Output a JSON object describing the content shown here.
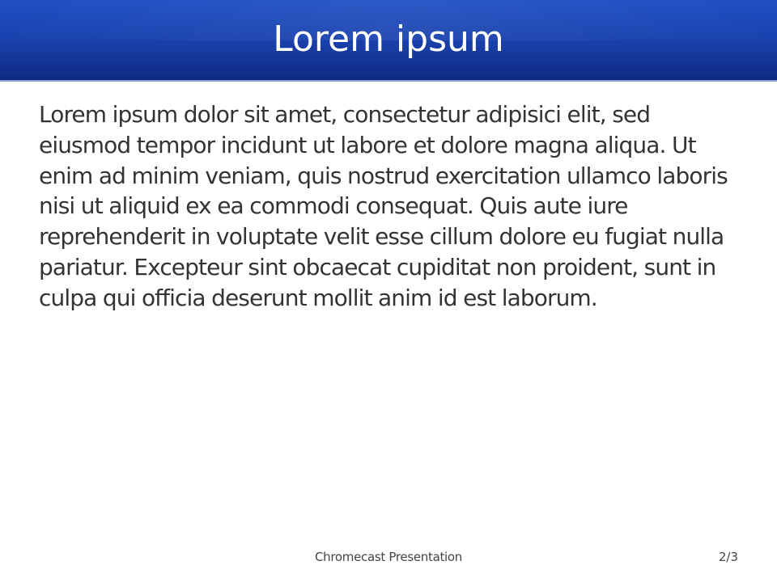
{
  "slide": {
    "title": "Lorem ipsum",
    "body": "Lorem ipsum dolor sit amet, consectetur adipisici elit, sed eiusmod tempor incidunt ut labore et dolore magna aliqua. Ut enim ad minim veniam, quis nostrud exercitation ullamco laboris nisi ut aliquid ex ea commodi consequat. Quis aute iure reprehenderit in voluptate velit esse cillum dolore eu fugiat nulla pariatur. Excepteur sint obcaecat cupiditat non proident, sunt in culpa qui officia deserunt mollit anim id est laborum."
  },
  "footer": {
    "label": "Chromecast Presentation",
    "page": "2/3"
  },
  "colors": {
    "title_bar": "#1a43b0",
    "title_text": "#ffffff",
    "body_text": "#333333",
    "footer_text": "#444444"
  }
}
